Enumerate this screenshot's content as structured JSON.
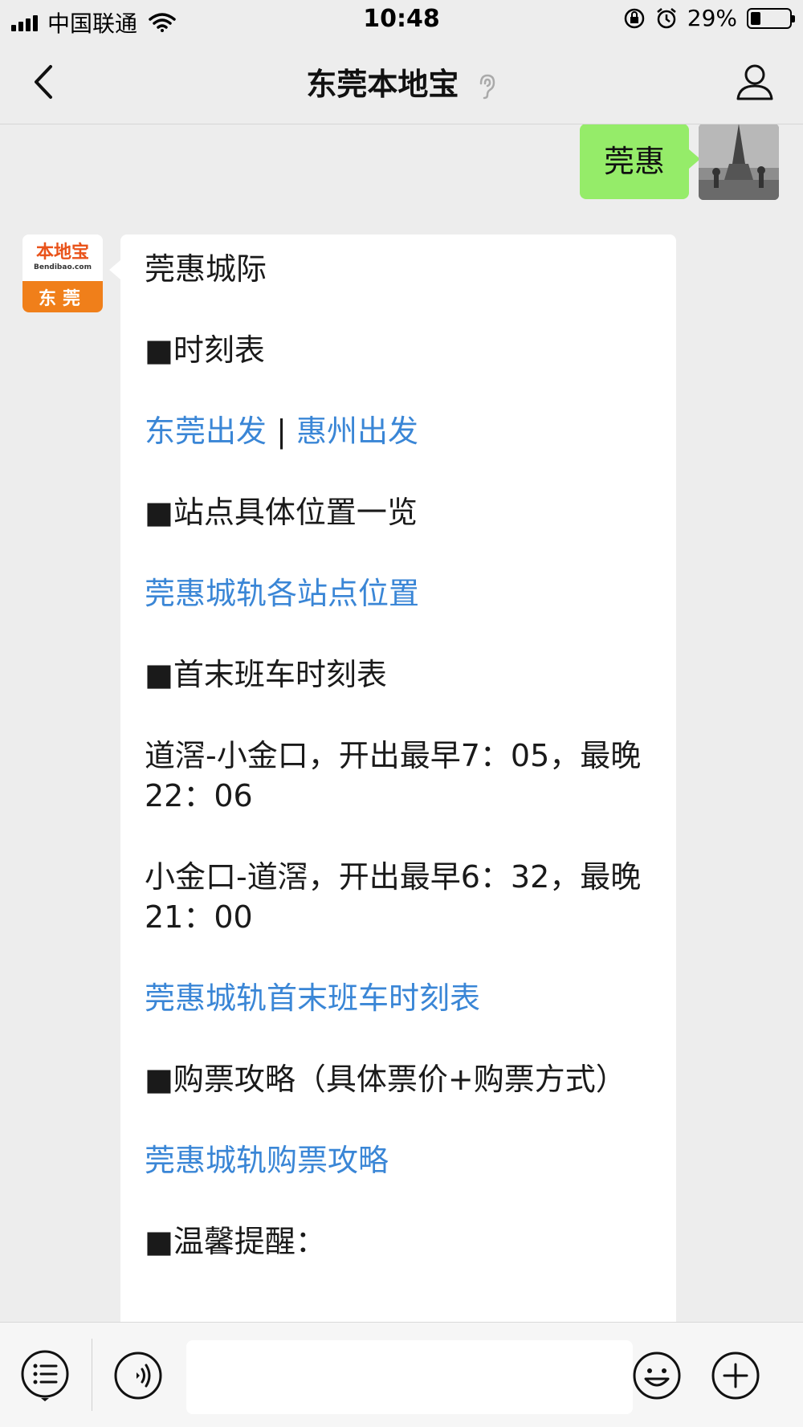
{
  "status_bar": {
    "carrier": "中国联通",
    "time": "10:48",
    "battery": "29%",
    "battery_level": 0.29
  },
  "nav": {
    "title": "东莞本地宝"
  },
  "chat": {
    "my_message": "莞惠",
    "bot_avatar": {
      "logo_text": "本地宝",
      "logo_domain": "Bendibao.com",
      "city": "东莞"
    },
    "reply": {
      "title": "莞惠城际",
      "schedule_heading": "■时刻表",
      "link_dongguan": "东莞出发",
      "separator": " | ",
      "link_huizhou": "惠州出发",
      "stations_heading": "■站点具体位置一览",
      "link_stations": "莞惠城轨各站点位置",
      "first_last_heading": "■首末班车时刻表",
      "route1": "道滘-小金口，开出最早7：05，最晚22：06",
      "route2": "小金口-道滘，开出最早6：32，最晚21：00",
      "link_first_last": "莞惠城轨首末班车时刻表",
      "ticket_heading": "■购票攻略（具体票价+购票方式）",
      "link_ticket": "莞惠城轨购票攻略",
      "tips_heading": "■温馨提醒："
    }
  },
  "input_bar": {
    "placeholder": ""
  }
}
